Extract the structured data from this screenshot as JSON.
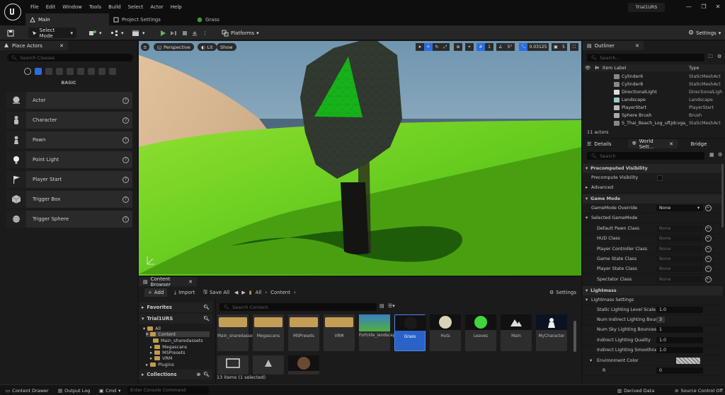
{
  "window": {
    "menu": [
      "File",
      "Edit",
      "Window",
      "Tools",
      "Build",
      "Select",
      "Actor",
      "Help"
    ],
    "tabs": [
      "Main",
      "Project Settings",
      "Grass"
    ],
    "project_name": "Trial1URS",
    "minimize": "—",
    "maximize": "❐",
    "close": "✕"
  },
  "toolbar": {
    "select_mode": "Select Mode",
    "platforms": "Platforms",
    "settings": "Settings"
  },
  "place_actors": {
    "tab": "Place Actors",
    "search_placeholder": "Search Classes",
    "category": "BASIC",
    "items": [
      "Actor",
      "Character",
      "Pawn",
      "Point Light",
      "Player Start",
      "Trigger Box",
      "Trigger Sphere"
    ]
  },
  "viewport": {
    "perspective": "Perspective",
    "lit": "Lit",
    "show": "Show",
    "grid_snap": "1",
    "rotation_snap": "5°",
    "scale_snap": "0.03125",
    "camera_speed": "5"
  },
  "content_browser": {
    "tab": "Content Browser",
    "add": "Add",
    "import": "Import",
    "save_all": "Save All",
    "path_root": "All",
    "path_leaf": "Content",
    "settings": "Settings",
    "favorites": "Favorites",
    "project": "Trial1URS",
    "collections": "Collections",
    "search_placeholder": "Search Content",
    "tree": [
      "All",
      "Content",
      "Main_sharedassets",
      "Megascans",
      "MSPresets",
      "VRM",
      "Plugins"
    ],
    "assets": [
      "Main_sharedassets",
      "Megascans",
      "MSPresets",
      "VRM",
      "Fortnite_landscape",
      "Grass",
      "Huts",
      "Leaves",
      "Main",
      "MyCharacter"
    ],
    "status": "13 items (1 selected)"
  },
  "outliner": {
    "tab": "Outliner",
    "search_placeholder": "Search...",
    "col_label": "Item Label",
    "col_type": "Type",
    "rows": [
      {
        "label": "Cylinder6",
        "type": "StaticMeshAct"
      },
      {
        "label": "Cylinder8",
        "type": "StaticMeshAct"
      },
      {
        "label": "DirectionalLight",
        "type": "DirectionalLigh"
      },
      {
        "label": "Landscape",
        "type": "Landscape"
      },
      {
        "label": "PlayerStart",
        "type": "PlayerStart"
      },
      {
        "label": "Sphere Brush",
        "type": "Brush"
      },
      {
        "label": "S_Thai_Beach_Log_uftjdcvga_",
        "type": "StaticMeshAct"
      }
    ],
    "count": "11 actors"
  },
  "details": {
    "tabs": [
      "Details",
      "World Sett...",
      "Bridge"
    ],
    "search_placeholder": "Search",
    "sections": {
      "precomputed_visibility": "Precomputed Visibility",
      "precompute_visibility": "Precompute Visibility",
      "advanced": "Advanced",
      "game_mode": "Game Mode",
      "gamemode_override": "GameMode Override",
      "gamemode_override_val": "None",
      "selected_gamemode": "Selected GameMode",
      "lightmass": "Lightmass",
      "lightmass_settings": "Lightmass Settings",
      "environment_color": "Environment Color",
      "r_label": "R",
      "r_value": "0"
    },
    "gamemode_props": [
      {
        "name": "Default Pawn Class",
        "value": "None"
      },
      {
        "name": "HUD Class",
        "value": "None"
      },
      {
        "name": "Player Controller Class",
        "value": "None"
      },
      {
        "name": "Game State Class",
        "value": "None"
      },
      {
        "name": "Player State Class",
        "value": "None"
      },
      {
        "name": "Spectator Class",
        "value": "None"
      }
    ],
    "lightmass_props": [
      {
        "name": "Static Lighting Level Scale",
        "value": "1.0"
      },
      {
        "name": "Num Indirect Lighting Boun...",
        "value": "3"
      },
      {
        "name": "Num Sky Lighting Bounces",
        "value": "1"
      },
      {
        "name": "Indirect Lighting Quality",
        "value": "1.0"
      },
      {
        "name": "Indirect Lighting Smoothne...",
        "value": "1.0"
      }
    ]
  },
  "statusbar": {
    "content_drawer": "Content Drawer",
    "output_log": "Output Log",
    "cmd": "Cmd",
    "console_placeholder": "Enter Console Command",
    "derived_data": "Derived Data",
    "source_control": "Source Control Off"
  }
}
